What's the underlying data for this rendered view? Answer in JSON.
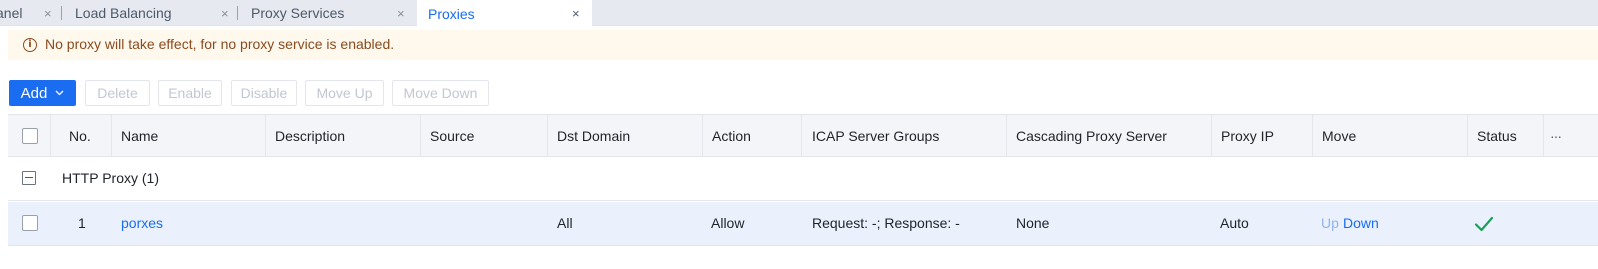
{
  "tabs": [
    {
      "label": "anel",
      "close": "×"
    },
    {
      "label": "Load Balancing",
      "close": "×"
    },
    {
      "label": "Proxy Services",
      "close": "×"
    },
    {
      "label": "Proxies",
      "close": "×",
      "active": true
    }
  ],
  "alert": {
    "icon": "info-icon",
    "icon_glyph": "i",
    "text": "No proxy will take effect, for no proxy service is enabled."
  },
  "toolbar": {
    "add_label": "Add",
    "add_caret": "⌄",
    "delete_label": "Delete",
    "enable_label": "Enable",
    "disable_label": "Disable",
    "move_up_label": "Move Up",
    "move_down_label": "Move Down"
  },
  "table": {
    "columns": [
      "No.",
      "Name",
      "Description",
      "Source",
      "Dst Domain",
      "Action",
      "ICAP Server Groups",
      "Cascading Proxy Server",
      "Proxy IP",
      "Move",
      "Status",
      "···"
    ],
    "group": {
      "label": "HTTP Proxy (1)"
    },
    "rows": [
      {
        "no": "1",
        "name": "porxes",
        "description": "",
        "source": "",
        "dst_domain": "All",
        "action": "Allow",
        "icap": "Request: -; Response: -",
        "cascading": "None",
        "proxy_ip": "Auto",
        "move_up": "Up",
        "move_down": "Down",
        "status": "enabled"
      }
    ]
  },
  "colors": {
    "accent": "#1a6df0",
    "alert_bg": "#fff8ed",
    "alert_text": "#8a4b1f",
    "row_selected_bg": "#eaf1fd",
    "status_ok": "#18a058"
  }
}
